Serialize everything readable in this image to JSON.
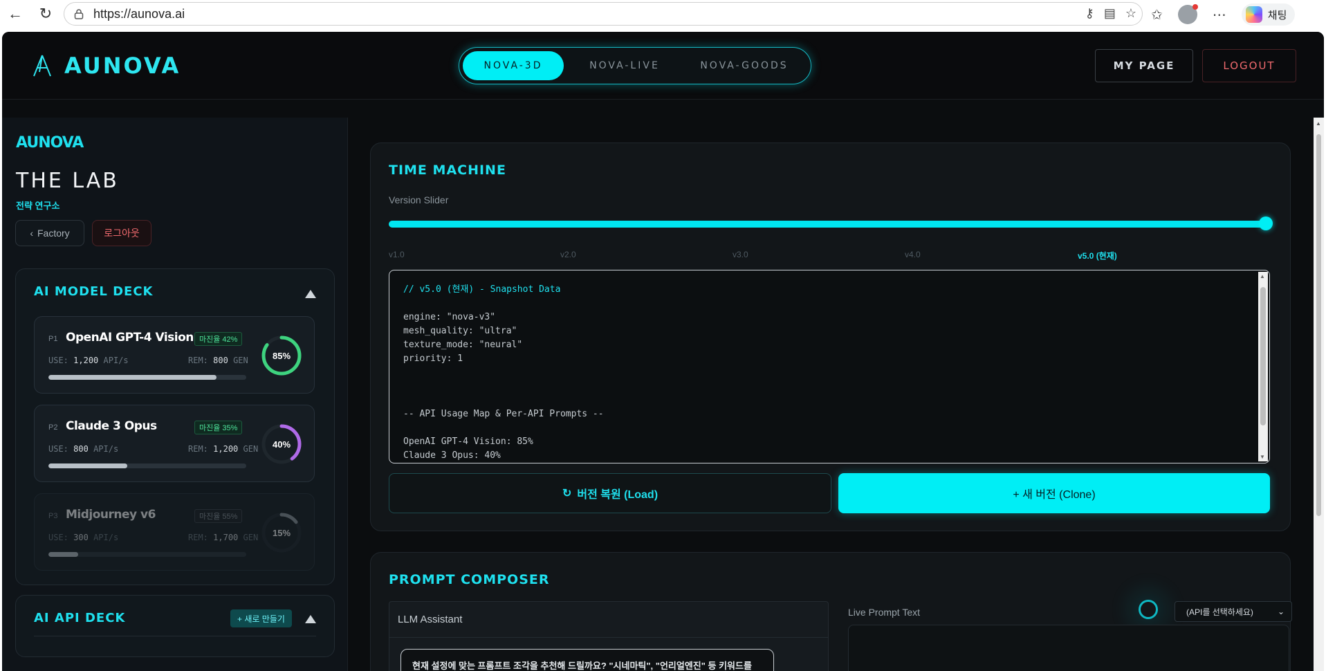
{
  "browser": {
    "url": "https://aunova.ai",
    "chat_label": "채팅"
  },
  "header": {
    "logo": "AUNOVA",
    "tabs": [
      "NOVA-3D",
      "NOVA-LIVE",
      "NOVA-GOODS"
    ],
    "active_tab": "NOVA-3D",
    "mypage_label": "MY PAGE",
    "logout_label": "LOGOUT"
  },
  "sidebar": {
    "brand": "AUNOVA",
    "title": "THE LAB",
    "subtitle": "전략 연구소",
    "factory_label": "Factory",
    "logout_label": "로그아웃",
    "model_deck": {
      "title": "AI MODEL DECK",
      "models": [
        {
          "rank": "P1",
          "name": "OpenAI GPT-4 Vision",
          "margin": "마진율 42%",
          "use_label": "USE:",
          "use_value": "1,200",
          "use_unit": "API/s",
          "rem_label": "REM:",
          "rem_value": "800",
          "rem_unit": "GEN",
          "usage_fraction": 0.85,
          "percent": "85%",
          "ring_color": "#3ed37f",
          "bar_fraction": 0.85
        },
        {
          "rank": "P2",
          "name": "Claude 3 Opus",
          "margin": "마진율 35%",
          "use_label": "USE:",
          "use_value": "800",
          "use_unit": "API/s",
          "rem_label": "REM:",
          "rem_value": "1,200",
          "rem_unit": "GEN",
          "usage_fraction": 0.4,
          "percent": "40%",
          "ring_color": "#b06ae8",
          "bar_fraction": 0.4
        },
        {
          "rank": "P3",
          "name": "Midjourney v6",
          "margin": "마진율 55%",
          "use_label": "USE:",
          "use_value": "300",
          "use_unit": "API/s",
          "rem_label": "REM:",
          "rem_value": "1,700",
          "rem_unit": "GEN",
          "usage_fraction": 0.15,
          "percent": "15%",
          "ring_color": "#8e969d",
          "bar_fraction": 0.15
        }
      ]
    },
    "api_deck": {
      "title": "AI API DECK",
      "new_label": "+ 새로 만들기"
    }
  },
  "time_machine": {
    "title": "TIME MACHINE",
    "slider_label": "Version Slider",
    "slider_value": 1.0,
    "ticks": [
      "v1.0",
      "v2.0",
      "v3.0",
      "v4.0",
      "v5.0 (현재)"
    ],
    "code_comment": "// v5.0 (현재) - Snapshot Data",
    "code_body": "engine: \"nova-v3\"\nmesh_quality: \"ultra\"\ntexture_mode: \"neural\"\npriority: 1\n\n\n\n-- API Usage Map & Per-API Prompts --\n\nOpenAI GPT-4 Vision: 85%\nClaude 3 Opus: 40%",
    "load_label": "버전 복원 (Load)",
    "clone_label": "+ 새 버전 (Clone)"
  },
  "prompt_composer": {
    "title": "PROMPT COMPOSER",
    "llm_title": "LLM Assistant",
    "llm_message": "현재 설정에 맞는 프롬프트 조각을 추천해 드릴까요? \"시네마틱\", \"언리얼엔진\" 등 키워드를 말씀해 주세요.",
    "live_label": "Live Prompt Text",
    "api_select": "(API를 선택하세요)"
  },
  "colors": {
    "accent": "#00eef5",
    "danger": "#f06a6e",
    "background": "#0b0d0f"
  }
}
